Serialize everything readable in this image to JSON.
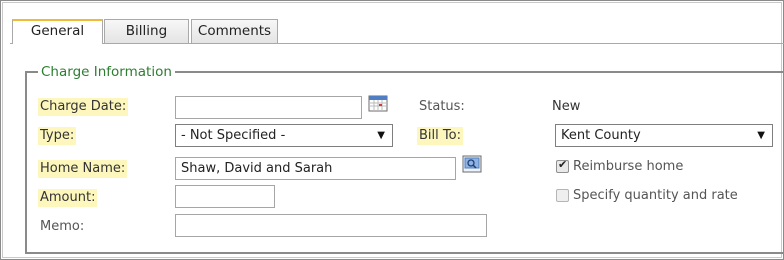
{
  "tabs": [
    {
      "label": "General",
      "active": true
    },
    {
      "label": "Billing",
      "active": false
    },
    {
      "label": "Comments",
      "active": false
    }
  ],
  "section": {
    "legend": "Charge Information"
  },
  "fields": {
    "charge_date": {
      "label": "Charge Date:",
      "value": "",
      "required": true
    },
    "type": {
      "label": "Type:",
      "selected": "- Not Specified -",
      "required": true
    },
    "home_name": {
      "label": "Home Name:",
      "value": "Shaw, David and Sarah",
      "required": true
    },
    "amount": {
      "label": "Amount:",
      "value": "",
      "required": true
    },
    "memo": {
      "label": "Memo:",
      "value": "",
      "required": false
    },
    "status": {
      "label": "Status:",
      "value": "New"
    },
    "bill_to": {
      "label": "Bill To:",
      "selected": "Kent County",
      "required": true
    },
    "reimburse_home": {
      "label": "Reimburse home",
      "checked": true
    },
    "specify_quantity": {
      "label": "Specify quantity and rate",
      "checked": false
    }
  },
  "icons": {
    "calendar": "calendar-icon",
    "lookup": "lookup-icon",
    "dropdown": "chevron-down-icon"
  },
  "colors": {
    "required_highlight": "#fdf7bd",
    "legend_text": "#2e7d32",
    "active_tab_accent": "#f0b93a"
  }
}
